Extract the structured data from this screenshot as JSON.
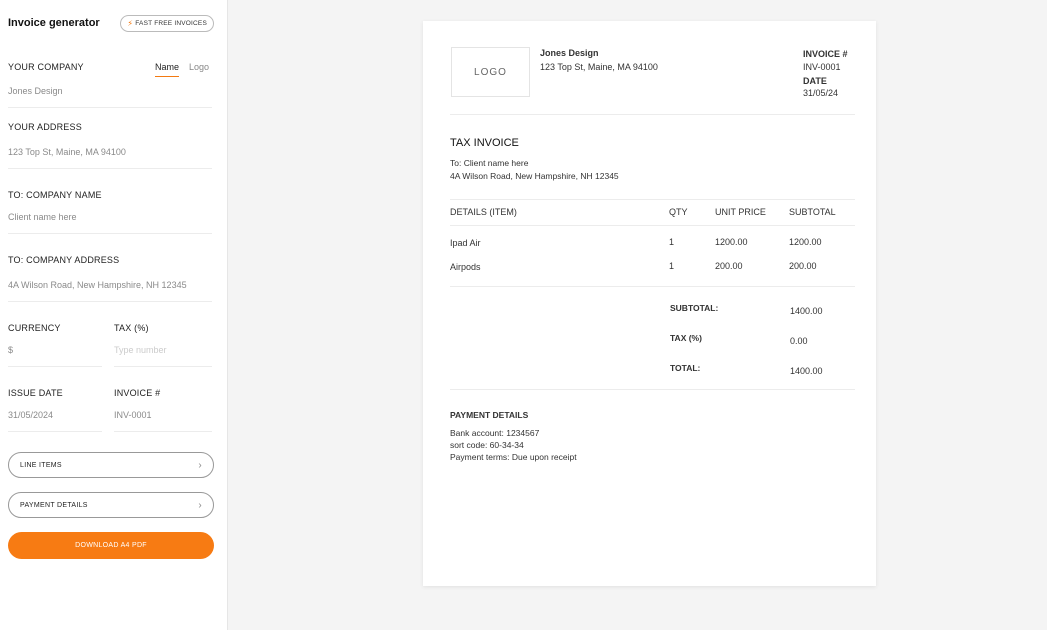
{
  "sidebar": {
    "title": "Invoice generator",
    "badge": "FAST FREE INVOICES",
    "company": {
      "label": "YOUR COMPANY",
      "value": "Jones Design",
      "toggle": [
        "Name",
        "Logo"
      ]
    },
    "address": {
      "label": "YOUR ADDRESS",
      "value": "123 Top St, Maine, MA 94100"
    },
    "to_company": {
      "label": "TO: COMPANY NAME",
      "value": "Client name here"
    },
    "to_address": {
      "label": "TO: COMPANY ADDRESS",
      "value": "4A Wilson Road, New Hampshire, NH 12345"
    },
    "currency": {
      "label": "CURRENCY",
      "value": "$"
    },
    "tax": {
      "label": "TAX (%)",
      "placeholder": "Type number"
    },
    "issue_date": {
      "label": "ISSUE DATE",
      "value": "31/05/2024"
    },
    "invoice_num": {
      "label": "INVOICE #",
      "value": "INV-0001"
    },
    "line_items_button": "LINE ITEMS",
    "payment_details_button": "PAYMENT DETAILS",
    "download_button": "DOWNLOAD A4 PDF"
  },
  "invoice": {
    "logo_placeholder": "LOGO",
    "company_name": "Jones Design",
    "company_address": "123 Top St, Maine, MA 94100",
    "invoice_label": "INVOICE #",
    "invoice_value": "INV-0001",
    "date_label": "DATE",
    "date_value": "31/05/24",
    "heading": "TAX INVOICE",
    "to_line": "To: Client name here",
    "to_address": "4A Wilson Road, New Hampshire, NH 12345",
    "columns": [
      "DETAILS (ITEM)",
      "QTY",
      "UNIT PRICE",
      "SUBTOTAL"
    ],
    "items": [
      {
        "name": "Ipad Air",
        "qty": "1",
        "unit": "1200.00",
        "subtotal": "1200.00"
      },
      {
        "name": "Airpods",
        "qty": "1",
        "unit": "200.00",
        "subtotal": "200.00"
      }
    ],
    "subtotal_label": "SUBTOTAL:",
    "subtotal_value": "1400.00",
    "tax_label": "TAX (%)",
    "tax_value": "0.00",
    "total_label": "TOTAL:",
    "total_value": "1400.00",
    "payment_heading": "PAYMENT DETAILS",
    "bank_account": "Bank account: 1234567",
    "sort_code": "sort code: 60-34-34",
    "payment_terms": "Payment terms: Due upon receipt"
  },
  "colors": {
    "accent": "#f77b13",
    "background": "#f4f4f4"
  },
  "icons": [
    "lightning-icon",
    "chevron-right-icon"
  ]
}
